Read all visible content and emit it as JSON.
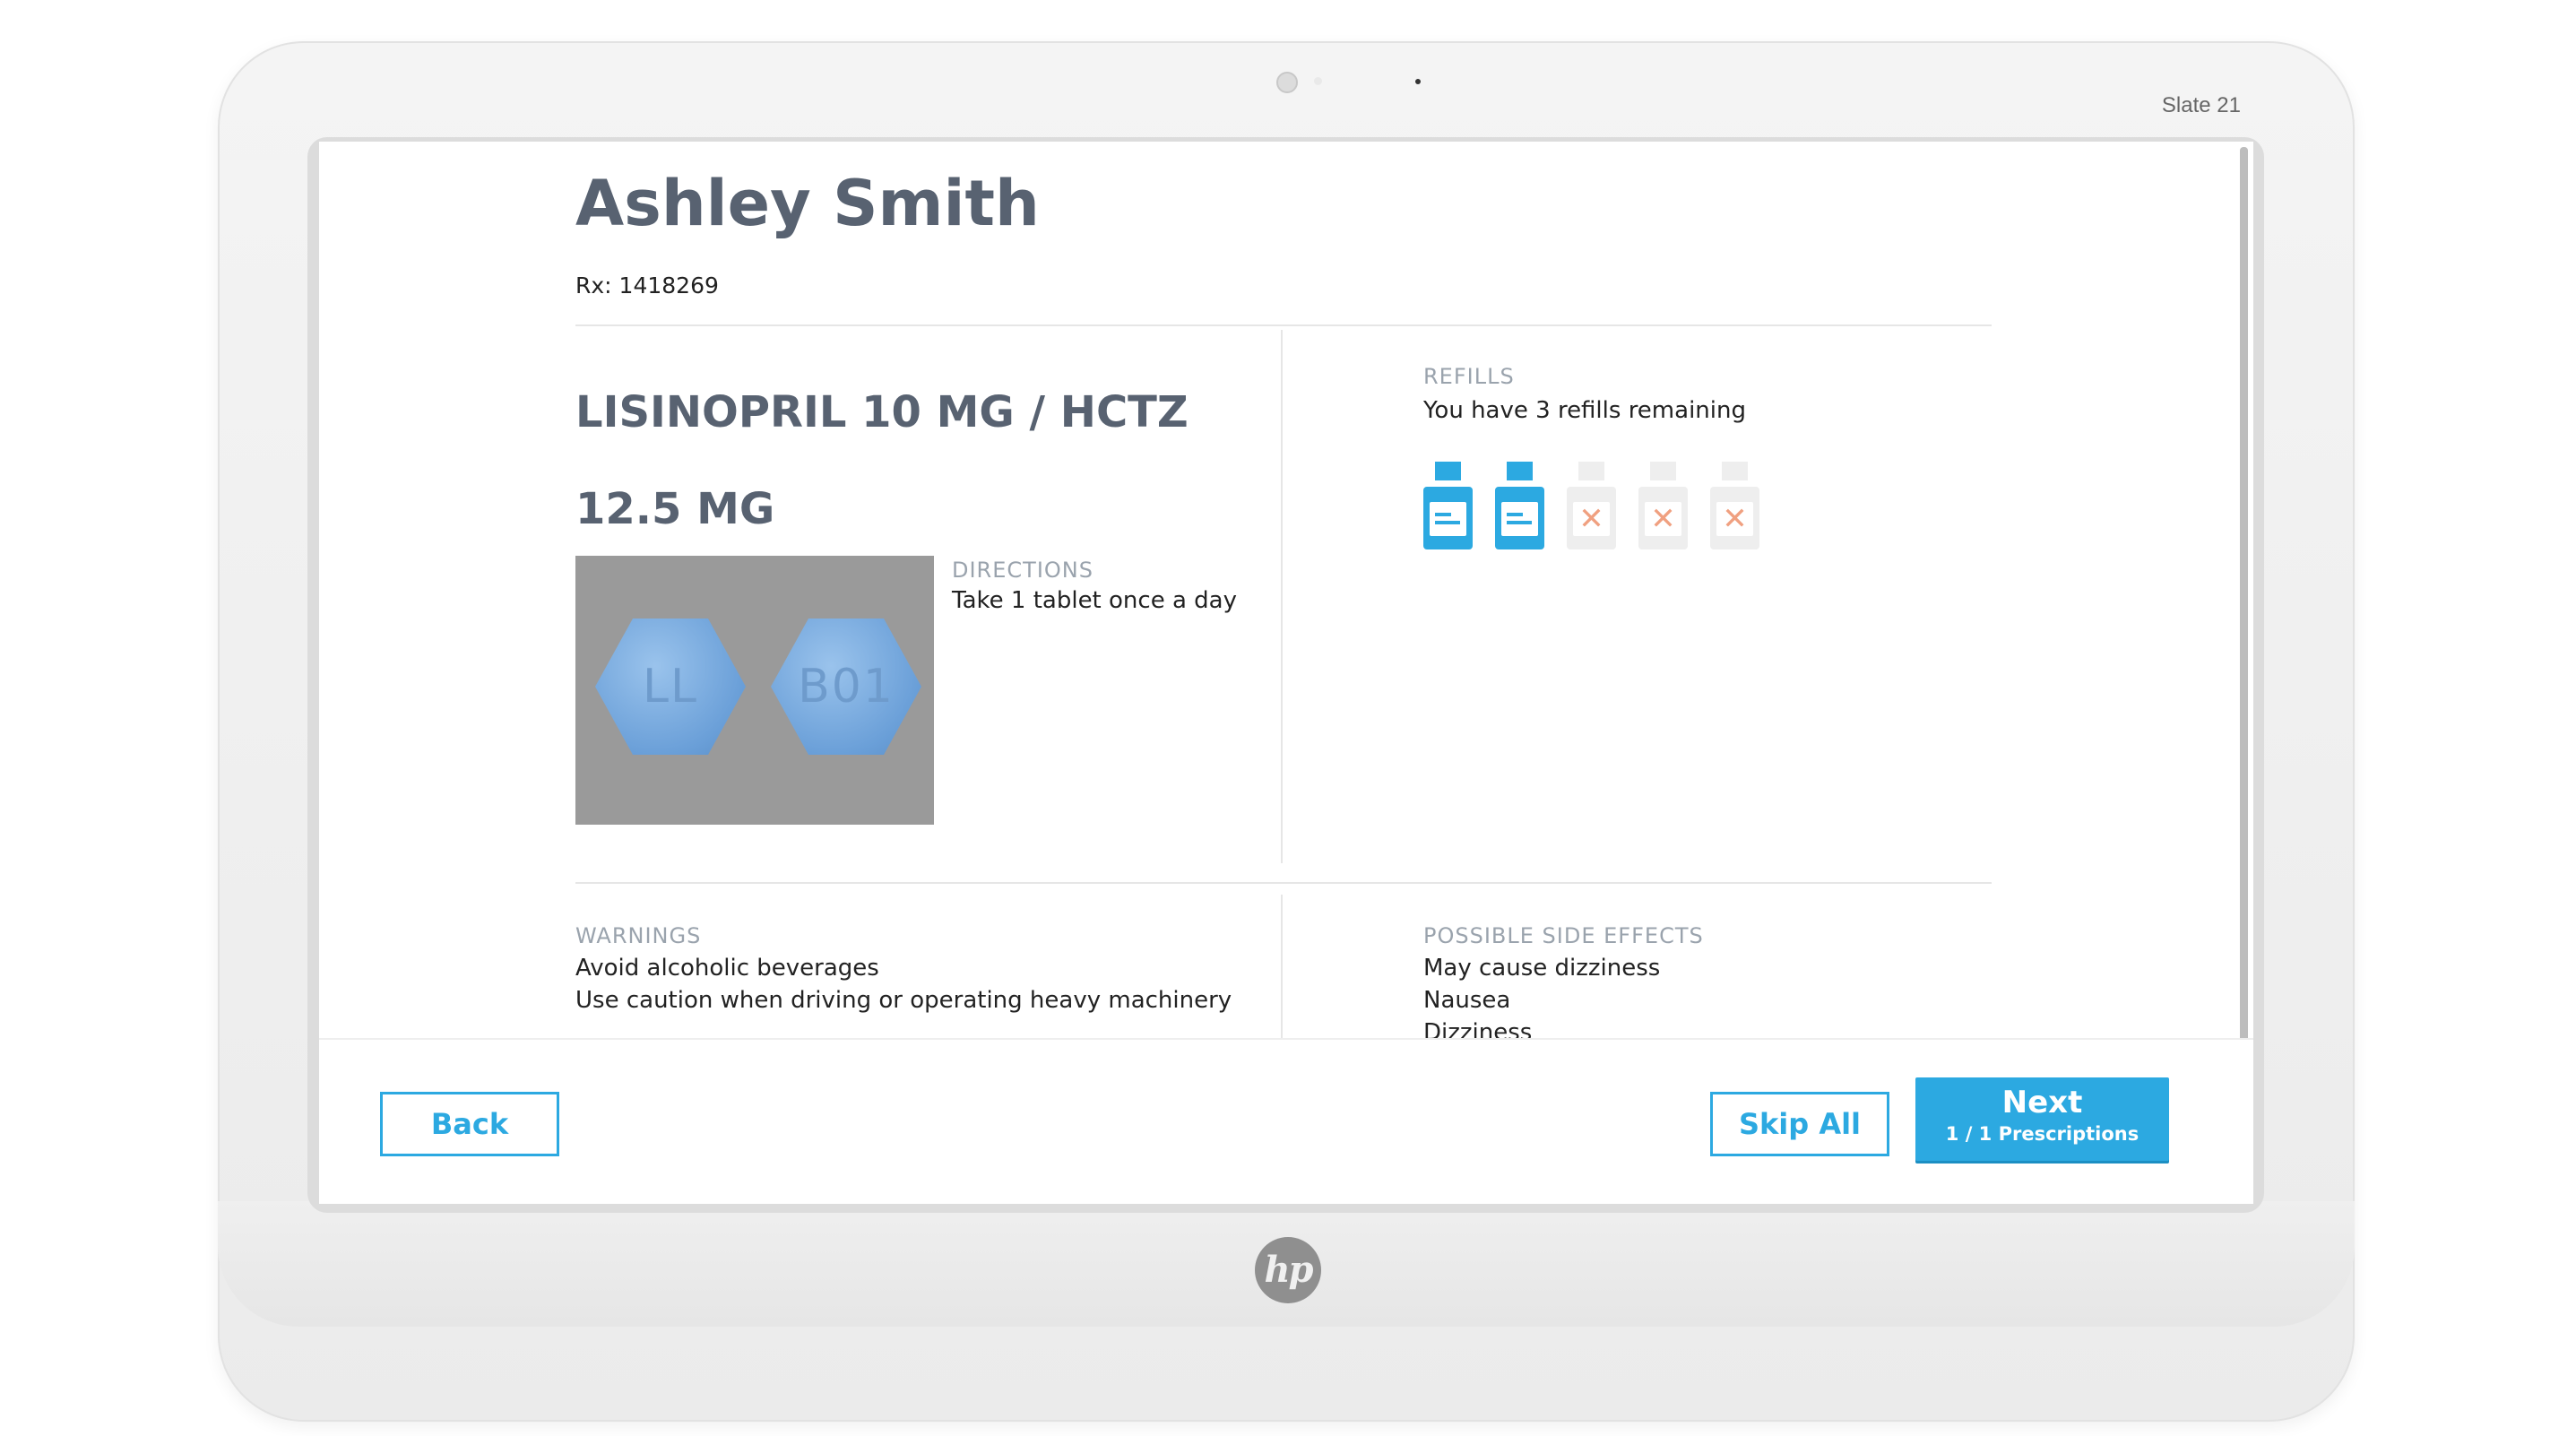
{
  "device": {
    "model_label": "Slate 21",
    "brand_logo": "hp"
  },
  "patient": {
    "name": "Ashley Smith",
    "rx": "Rx: 1418269"
  },
  "medication": {
    "name": "LISINOPRIL 10 MG / HCTZ 12.5 MG",
    "pill_imprints": [
      "LL",
      "B01"
    ],
    "directions_label": "DIRECTIONS",
    "directions": "Take 1 tablet once a day"
  },
  "refills": {
    "label": "REFILLS",
    "text": "You have 3 refills remaining",
    "bottles": [
      "filled",
      "filled",
      "empty",
      "empty",
      "empty"
    ]
  },
  "warnings": {
    "label": "WARNINGS",
    "items": [
      "Avoid alcoholic beverages",
      "Use caution when driving or operating heavy machinery"
    ]
  },
  "side_effects": {
    "label": "POSSIBLE SIDE EFFECTS",
    "items": [
      "May cause dizziness",
      "Nausea",
      "Dizziness"
    ]
  },
  "footer": {
    "back_label": "Back",
    "skip_label": "Skip All",
    "next_label": "Next",
    "next_sub": "1  /  1 Prescriptions"
  },
  "colors": {
    "accent": "#2ca9e1",
    "heading": "#586271",
    "muted_label": "#9aa3ad"
  }
}
